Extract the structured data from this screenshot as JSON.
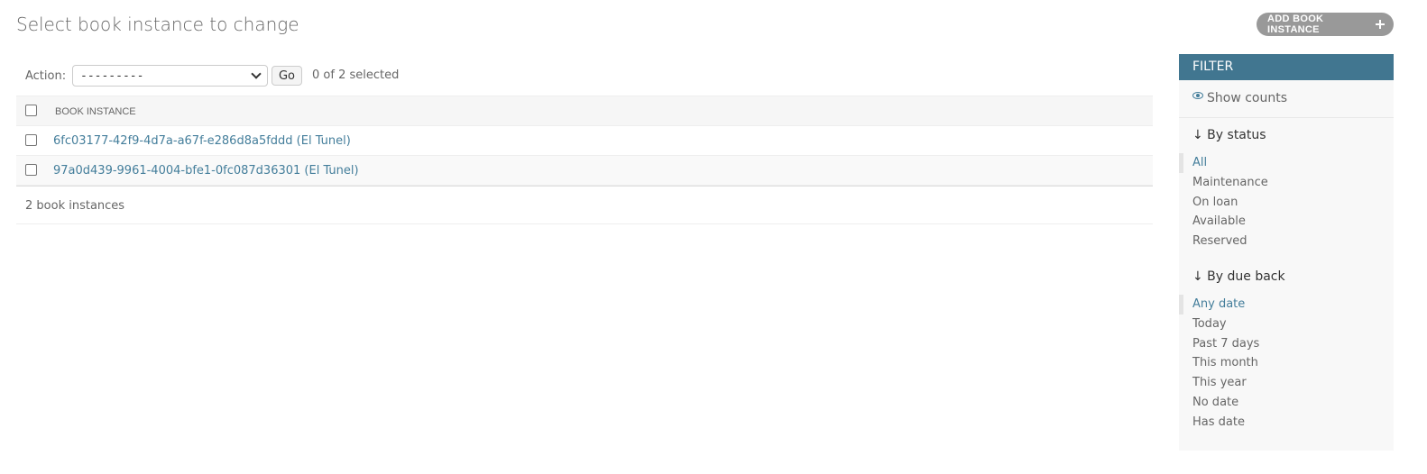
{
  "page": {
    "title": "Select book instance to change",
    "add_button_label": "Add book instance"
  },
  "actions": {
    "label": "Action:",
    "select_value": "---------",
    "go_label": "Go",
    "selection_counter": "0 of 2 selected"
  },
  "results": {
    "column_header": "Book instance",
    "rows": [
      {
        "label": "6fc03177-42f9-4d7a-a67f-e286d8a5fddd (El Tunel)"
      },
      {
        "label": "97a0d439-9961-4004-bfe1-0fc087d36301 (El Tunel)"
      }
    ],
    "count_text": "2 book instances"
  },
  "filter": {
    "heading": "Filter",
    "show_counts": "Show counts",
    "groups": [
      {
        "title": "↓ By status",
        "options": [
          "All",
          "Maintenance",
          "On loan",
          "Available",
          "Reserved"
        ],
        "selected": "All"
      },
      {
        "title": "↓ By due back",
        "options": [
          "Any date",
          "Today",
          "Past 7 days",
          "This month",
          "This year",
          "No date",
          "Has date"
        ],
        "selected": "Any date"
      }
    ]
  },
  "colors": {
    "link": "#447e9b",
    "filter_header": "#417690",
    "add_button": "#999999"
  },
  "icons": [
    "plus-icon",
    "chevron-down-icon",
    "eye-icon"
  ]
}
